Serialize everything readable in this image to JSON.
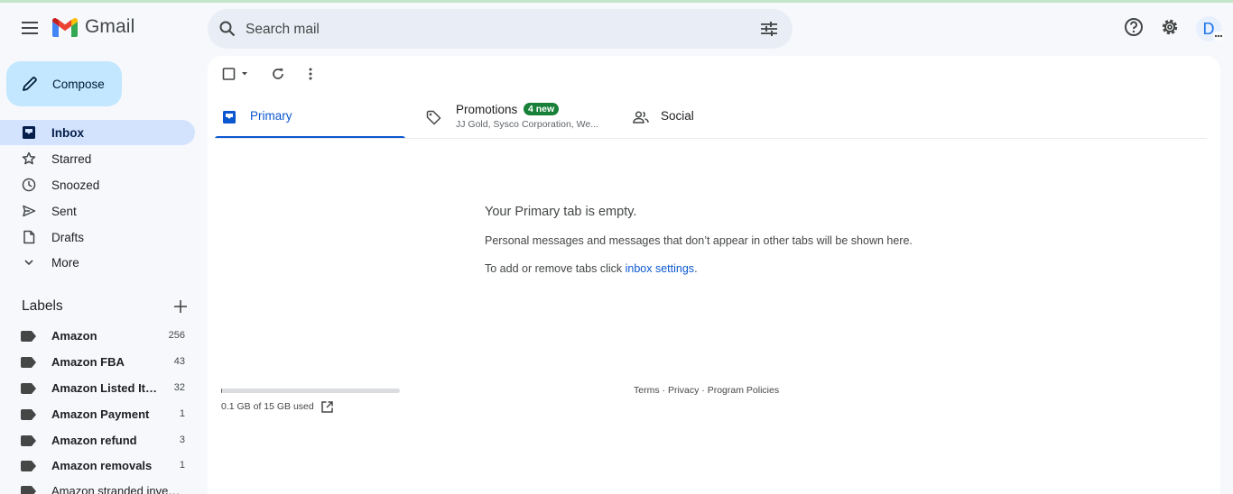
{
  "header": {
    "app_name": "Gmail",
    "search_placeholder": "Search mail",
    "avatar_initial": "D"
  },
  "compose": {
    "label": "Compose"
  },
  "nav": [
    {
      "label": "Inbox",
      "icon": "inbox-icon",
      "active": true
    },
    {
      "label": "Starred",
      "icon": "star-icon"
    },
    {
      "label": "Snoozed",
      "icon": "clock-icon"
    },
    {
      "label": "Sent",
      "icon": "send-icon"
    },
    {
      "label": "Drafts",
      "icon": "draft-icon"
    },
    {
      "label": "More",
      "icon": "chevron-down-icon"
    }
  ],
  "labels": {
    "title": "Labels",
    "items": [
      {
        "name": "Amazon",
        "count": "256"
      },
      {
        "name": "Amazon FBA",
        "count": "43"
      },
      {
        "name": "Amazon Listed Items",
        "count": "32"
      },
      {
        "name": "Amazon Payment",
        "count": "1"
      },
      {
        "name": "Amazon refund",
        "count": "3"
      },
      {
        "name": "Amazon removals",
        "count": "1"
      },
      {
        "name": "Amazon stranded invent...",
        "count": ""
      }
    ]
  },
  "tabs": {
    "primary": {
      "label": "Primary"
    },
    "promotions": {
      "label": "Promotions",
      "badge": "4 new",
      "senders": "JJ Gold, Sysco Corporation, We..."
    },
    "social": {
      "label": "Social"
    }
  },
  "empty": {
    "title": "Your Primary tab is empty.",
    "desc": "Personal messages and messages that don’t appear in other tabs will be shown here.",
    "hint_prefix": "To add or remove tabs click ",
    "hint_link": "inbox settings",
    "hint_suffix": "."
  },
  "storage": {
    "text": "0.1 GB of 15 GB used",
    "used_fraction": 0.007
  },
  "footer": {
    "terms": "Terms",
    "privacy": "Privacy",
    "policies": "Program Policies",
    "sep": " · "
  },
  "colors": {
    "accent": "#0b57d0",
    "compose_bg": "#c2e7ff",
    "active_nav": "#d3e3fd",
    "badge_green": "#188038"
  }
}
